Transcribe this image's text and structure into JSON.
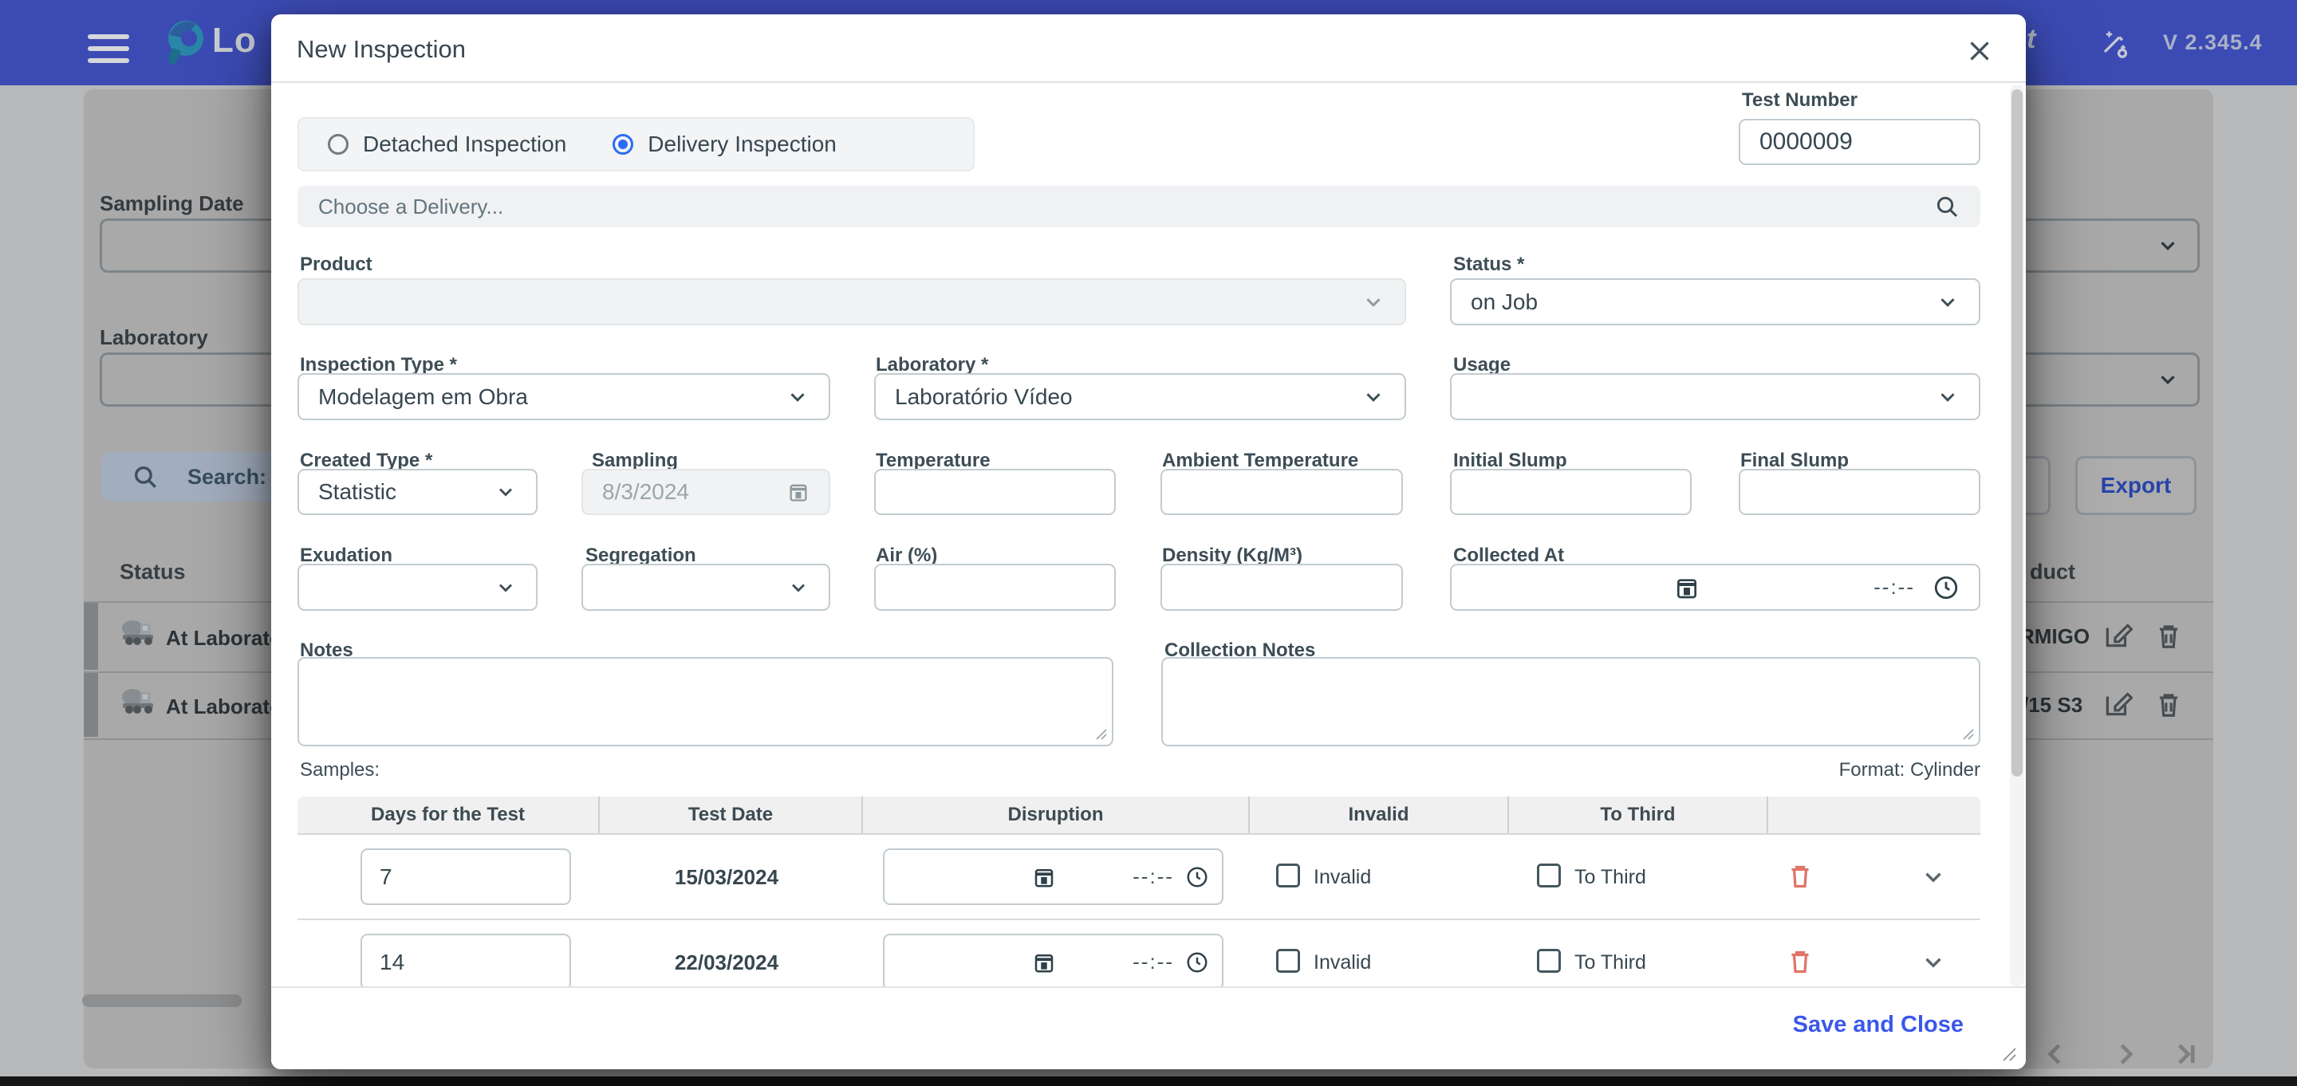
{
  "header": {
    "logo_fragment": "Lo",
    "user_fragment": "t",
    "version": "V 2.345.4"
  },
  "background": {
    "filters": {
      "sampling_date_label": "Sampling Date",
      "laboratory_label": "Laboratory",
      "search_label": "Search:"
    },
    "export_label": "Export",
    "table": {
      "status_header": "Status",
      "product_header_fragment": "duct",
      "rows": [
        {
          "status": "At Laboratory",
          "product_fragment": "RMIGO"
        },
        {
          "status": "At Laboratory",
          "product_fragment": "/15 S3"
        }
      ]
    }
  },
  "modal": {
    "title": "New Inspection",
    "inspection_kind": {
      "detached_label": "Detached Inspection",
      "delivery_label": "Delivery Inspection",
      "selected": "delivery"
    },
    "test_number": {
      "label": "Test Number",
      "value": "0000009"
    },
    "delivery_picker": {
      "placeholder": "Choose a Delivery..."
    },
    "product": {
      "label": "Product",
      "value": ""
    },
    "status": {
      "label": "Status *",
      "value": "on Job"
    },
    "inspection_type": {
      "label": "Inspection Type *",
      "value": "Modelagem em Obra"
    },
    "laboratory": {
      "label": "Laboratory *",
      "value": "Laboratório Vídeo"
    },
    "usage": {
      "label": "Usage",
      "value": ""
    },
    "created_type": {
      "label": "Created Type *",
      "value": "Statistic"
    },
    "sampling": {
      "label": "Sampling",
      "value": "8/3/2024"
    },
    "temperature": {
      "label": "Temperature",
      "value": ""
    },
    "ambient_temperature": {
      "label": "Ambient Temperature",
      "value": ""
    },
    "initial_slump": {
      "label": "Initial Slump",
      "value": ""
    },
    "final_slump": {
      "label": "Final Slump",
      "value": ""
    },
    "exudation": {
      "label": "Exudation",
      "value": ""
    },
    "segregation": {
      "label": "Segregation",
      "value": ""
    },
    "air": {
      "label": "Air (%)",
      "value": ""
    },
    "density": {
      "label": "Density (Kg/M³)",
      "value": ""
    },
    "collected_at": {
      "label": "Collected At",
      "time_placeholder": "--:--"
    },
    "notes": {
      "label": "Notes",
      "value": ""
    },
    "collection_notes": {
      "label": "Collection Notes",
      "value": ""
    },
    "samples": {
      "label": "Samples:",
      "format_label": "Format: Cylinder",
      "columns": [
        "Days for the Test",
        "Test Date",
        "Disruption",
        "Invalid",
        "To Third"
      ],
      "rows": [
        {
          "days": "7",
          "test_date": "15/03/2024",
          "time_placeholder": "--:--",
          "invalid_label": "Invalid",
          "to_third_label": "To Third"
        },
        {
          "days": "14",
          "test_date": "22/03/2024",
          "time_placeholder": "--:--",
          "invalid_label": "Invalid",
          "to_third_label": "To Third"
        }
      ]
    },
    "footer": {
      "save_label": "Save and Close"
    }
  },
  "colors": {
    "header_blue": "#3c4bb4",
    "accent_blue": "#3a57ec",
    "radio_selected": "#2a6cf4",
    "danger_red": "#e0756a"
  }
}
